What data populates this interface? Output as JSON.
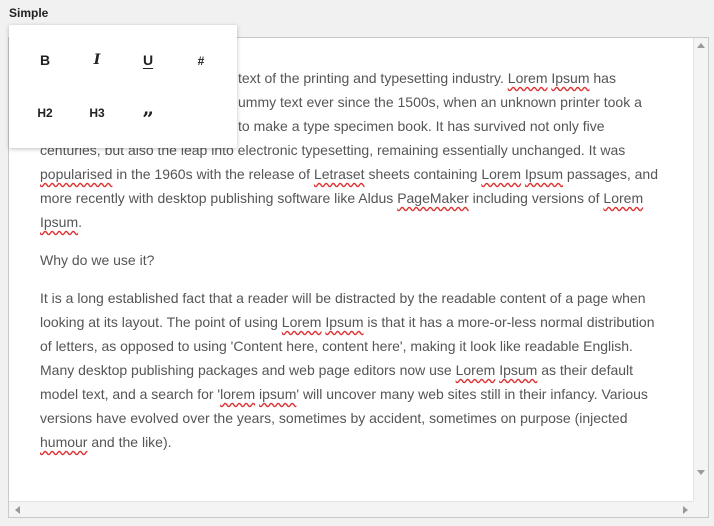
{
  "field": {
    "label": "Simple"
  },
  "toolbar": {
    "bold": "B",
    "italic": "I",
    "underline": "U",
    "heading_hash": "#",
    "h2": "H2",
    "h3": "H3",
    "quote": "”"
  },
  "editor": {
    "p1": {
      "a": "text of the printing and typesetting industry. ",
      "b": "Lorem",
      "c": " ",
      "d": "Ipsum",
      "e": " has",
      "f": "ummy text ever since the 1500s, when an unknown printer took a",
      "g": "to make a type specimen book. It has survived not only five",
      "h": "centuries, but also the leap into electronic typesetting, remaining essentially unchanged. It was ",
      "i": "popularised",
      "j": " in the 1960s with the release of ",
      "k": "Letraset",
      "l": " sheets containing ",
      "m": "Lorem",
      "n": " ",
      "o": "Ipsum",
      "p": " passages, and more recently with desktop publishing software like Aldus ",
      "q": "PageMaker",
      "r": " including versions of ",
      "s": "Lorem",
      "t": " ",
      "u": "Ipsum",
      "v": "."
    },
    "p2": "Why do we use it?",
    "p3": {
      "a": "It is a long established fact that a reader will be distracted by the readable content of a page when looking at its layout. The point of using ",
      "b": "Lorem",
      "c": " ",
      "d": "Ipsum",
      "e": " is that it has a more-or-less normal distribution of letters, as opposed to using 'Content here, content here', making it look like readable English. Many desktop publishing packages and web page editors now use ",
      "f": "Lorem",
      "g": " ",
      "h": "Ipsum",
      "i": " as their default model text, and a search for '",
      "j": "lorem",
      "k": " ",
      "l": "ipsum",
      "m": "' will uncover many web sites still in their infancy. Various versions have evolved over the years, sometimes by accident, sometimes on purpose (injected ",
      "n": "humour",
      "o": " and the like)."
    }
  }
}
